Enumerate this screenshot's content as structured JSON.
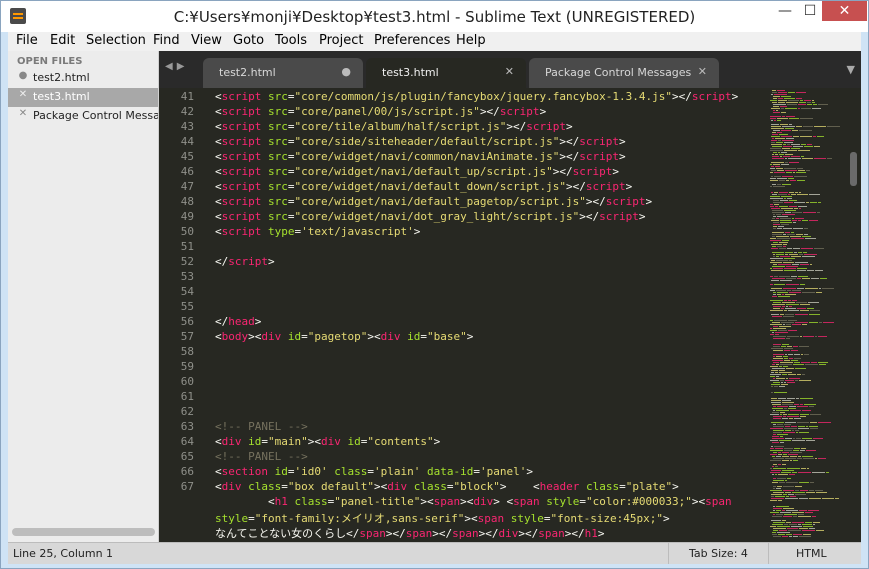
{
  "window": {
    "title": "C:¥Users¥monji¥Desktop¥test3.html - Sublime Text (UNREGISTERED)",
    "min_glyph": "—",
    "max_glyph": "☐",
    "close_glyph": "✕"
  },
  "menu": [
    "File",
    "Edit",
    "Selection",
    "Find",
    "View",
    "Goto",
    "Tools",
    "Project",
    "Preferences",
    "Help"
  ],
  "sidebar": {
    "header": "OPEN FILES",
    "files": [
      {
        "name": "test2.html",
        "mark": "●",
        "active": false
      },
      {
        "name": "test3.html",
        "mark": "✕",
        "active": true
      },
      {
        "name": "Package Control Messages",
        "mark": "✕",
        "active": false
      }
    ]
  },
  "tabs": {
    "nav_left": "◀",
    "nav_right": "▶",
    "dropdown": "▼",
    "items": [
      {
        "label": "test2.html",
        "ctl": "●",
        "active": false
      },
      {
        "label": "test3.html",
        "ctl": "✕",
        "active": true
      },
      {
        "label": "Package Control Messages",
        "ctl": "✕",
        "active": false
      }
    ]
  },
  "editor": {
    "line_numbers": [
      "41",
      "42",
      "43",
      "44",
      "45",
      "46",
      "47",
      "48",
      "49",
      "50",
      "51",
      "52",
      "53",
      "54",
      "55",
      "56",
      "57",
      "58",
      "59",
      "60",
      "61",
      "62",
      "63",
      "64",
      "65",
      "66",
      "67",
      "",
      "",
      ""
    ],
    "lines": [
      [
        [
          "p",
          "<"
        ],
        [
          "t",
          "script"
        ],
        [
          "p",
          " "
        ],
        [
          "a",
          "src"
        ],
        [
          "p",
          "="
        ],
        [
          "s",
          "\"core/common/js/plugin/fancybox/jquery.fancybox-1.3.4.js\""
        ],
        [
          "p",
          "></"
        ],
        [
          "t",
          "script"
        ],
        [
          "p",
          ">"
        ]
      ],
      [
        [
          "p",
          "<"
        ],
        [
          "t",
          "script"
        ],
        [
          "p",
          " "
        ],
        [
          "a",
          "src"
        ],
        [
          "p",
          "="
        ],
        [
          "s",
          "\"core/panel/00/js/script.js\""
        ],
        [
          "p",
          "></"
        ],
        [
          "t",
          "script"
        ],
        [
          "p",
          ">"
        ]
      ],
      [
        [
          "p",
          "<"
        ],
        [
          "t",
          "script"
        ],
        [
          "p",
          " "
        ],
        [
          "a",
          "src"
        ],
        [
          "p",
          "="
        ],
        [
          "s",
          "\"core/tile/album/half/script.js\""
        ],
        [
          "p",
          "></"
        ],
        [
          "t",
          "script"
        ],
        [
          "p",
          ">"
        ]
      ],
      [
        [
          "p",
          "<"
        ],
        [
          "t",
          "script"
        ],
        [
          "p",
          " "
        ],
        [
          "a",
          "src"
        ],
        [
          "p",
          "="
        ],
        [
          "s",
          "\"core/side/siteheader/default/script.js\""
        ],
        [
          "p",
          "></"
        ],
        [
          "t",
          "script"
        ],
        [
          "p",
          ">"
        ]
      ],
      [
        [
          "p",
          "<"
        ],
        [
          "t",
          "script"
        ],
        [
          "p",
          " "
        ],
        [
          "a",
          "src"
        ],
        [
          "p",
          "="
        ],
        [
          "s",
          "\"core/widget/navi/common/naviAnimate.js\""
        ],
        [
          "p",
          "></"
        ],
        [
          "t",
          "script"
        ],
        [
          "p",
          ">"
        ]
      ],
      [
        [
          "p",
          "<"
        ],
        [
          "t",
          "script"
        ],
        [
          "p",
          " "
        ],
        [
          "a",
          "src"
        ],
        [
          "p",
          "="
        ],
        [
          "s",
          "\"core/widget/navi/default_up/script.js\""
        ],
        [
          "p",
          "></"
        ],
        [
          "t",
          "script"
        ],
        [
          "p",
          ">"
        ]
      ],
      [
        [
          "p",
          "<"
        ],
        [
          "t",
          "script"
        ],
        [
          "p",
          " "
        ],
        [
          "a",
          "src"
        ],
        [
          "p",
          "="
        ],
        [
          "s",
          "\"core/widget/navi/default_down/script.js\""
        ],
        [
          "p",
          "></"
        ],
        [
          "t",
          "script"
        ],
        [
          "p",
          ">"
        ]
      ],
      [
        [
          "p",
          "<"
        ],
        [
          "t",
          "script"
        ],
        [
          "p",
          " "
        ],
        [
          "a",
          "src"
        ],
        [
          "p",
          "="
        ],
        [
          "s",
          "\"core/widget/navi/default_pagetop/script.js\""
        ],
        [
          "p",
          "></"
        ],
        [
          "t",
          "script"
        ],
        [
          "p",
          ">"
        ]
      ],
      [
        [
          "p",
          "<"
        ],
        [
          "t",
          "script"
        ],
        [
          "p",
          " "
        ],
        [
          "a",
          "src"
        ],
        [
          "p",
          "="
        ],
        [
          "s",
          "\"core/widget/navi/dot_gray_light/script.js\""
        ],
        [
          "p",
          "></"
        ],
        [
          "t",
          "script"
        ],
        [
          "p",
          ">"
        ]
      ],
      [
        [
          "p",
          "<"
        ],
        [
          "t",
          "script"
        ],
        [
          "p",
          " "
        ],
        [
          "a",
          "type"
        ],
        [
          "p",
          "="
        ],
        [
          "s",
          "'text/javascript'"
        ],
        [
          "p",
          ">"
        ]
      ],
      [],
      [
        [
          "p",
          "</"
        ],
        [
          "t",
          "script"
        ],
        [
          "p",
          ">"
        ]
      ],
      [],
      [],
      [],
      [
        [
          "p",
          "</"
        ],
        [
          "t",
          "head"
        ],
        [
          "p",
          ">"
        ]
      ],
      [
        [
          "p",
          "<"
        ],
        [
          "t",
          "body"
        ],
        [
          "p",
          "><"
        ],
        [
          "t",
          "div"
        ],
        [
          "p",
          " "
        ],
        [
          "a",
          "id"
        ],
        [
          "p",
          "="
        ],
        [
          "s",
          "\"pagetop\""
        ],
        [
          "p",
          "><"
        ],
        [
          "t",
          "div"
        ],
        [
          "p",
          " "
        ],
        [
          "a",
          "id"
        ],
        [
          "p",
          "="
        ],
        [
          "s",
          "\"base\""
        ],
        [
          "p",
          ">"
        ]
      ],
      [],
      [],
      [],
      [],
      [],
      [
        [
          "c",
          "<!-- PANEL -->"
        ]
      ],
      [
        [
          "p",
          "<"
        ],
        [
          "t",
          "div"
        ],
        [
          "p",
          " "
        ],
        [
          "a",
          "id"
        ],
        [
          "p",
          "="
        ],
        [
          "s",
          "\"main\""
        ],
        [
          "p",
          "><"
        ],
        [
          "t",
          "div"
        ],
        [
          "p",
          " "
        ],
        [
          "a",
          "id"
        ],
        [
          "p",
          "="
        ],
        [
          "s",
          "\"contents\""
        ],
        [
          "p",
          ">"
        ]
      ],
      [
        [
          "c",
          "<!-- PANEL -->"
        ]
      ],
      [
        [
          "p",
          "<"
        ],
        [
          "t",
          "section"
        ],
        [
          "p",
          " "
        ],
        [
          "a",
          "id"
        ],
        [
          "p",
          "="
        ],
        [
          "s",
          "'id0'"
        ],
        [
          "p",
          " "
        ],
        [
          "a",
          "class"
        ],
        [
          "p",
          "="
        ],
        [
          "s",
          "'plain'"
        ],
        [
          "p",
          " "
        ],
        [
          "a",
          "data-id"
        ],
        [
          "p",
          "="
        ],
        [
          "s",
          "'panel'"
        ],
        [
          "p",
          ">"
        ]
      ],
      [
        [
          "p",
          "<"
        ],
        [
          "t",
          "div"
        ],
        [
          "p",
          " "
        ],
        [
          "a",
          "class"
        ],
        [
          "p",
          "="
        ],
        [
          "s",
          "\"box default\""
        ],
        [
          "p",
          "><"
        ],
        [
          "t",
          "div"
        ],
        [
          "p",
          " "
        ],
        [
          "a",
          "class"
        ],
        [
          "p",
          "="
        ],
        [
          "s",
          "\"block\""
        ],
        [
          "p",
          ">    <"
        ],
        [
          "t",
          "header"
        ],
        [
          "p",
          " "
        ],
        [
          "a",
          "class"
        ],
        [
          "p",
          "="
        ],
        [
          "s",
          "\"plate\""
        ],
        [
          "p",
          ">"
        ]
      ],
      [
        [
          "p",
          "        <"
        ],
        [
          "t",
          "h1"
        ],
        [
          "p",
          " "
        ],
        [
          "a",
          "class"
        ],
        [
          "p",
          "="
        ],
        [
          "s",
          "\"panel-title\""
        ],
        [
          "p",
          "><"
        ],
        [
          "t",
          "span"
        ],
        [
          "p",
          "><"
        ],
        [
          "t",
          "div"
        ],
        [
          "p",
          "> <"
        ],
        [
          "t",
          "span"
        ],
        [
          "p",
          " "
        ],
        [
          "a",
          "style"
        ],
        [
          "p",
          "="
        ],
        [
          "s",
          "\"color:#000033;\""
        ],
        [
          "p",
          "><"
        ],
        [
          "t",
          "span"
        ]
      ],
      [
        [
          "a",
          "style"
        ],
        [
          "p",
          "="
        ],
        [
          "s",
          "\"font-family:メイリオ,sans-serif\""
        ],
        [
          "p",
          "><"
        ],
        [
          "t",
          "span"
        ],
        [
          "p",
          " "
        ],
        [
          "a",
          "style"
        ],
        [
          "p",
          "="
        ],
        [
          "s",
          "\"font-size:45px;\""
        ],
        [
          "p",
          ">"
        ]
      ],
      [
        [
          "p",
          "なんてことない女のくらし</"
        ],
        [
          "t",
          "span"
        ],
        [
          "p",
          "></"
        ],
        [
          "t",
          "span"
        ],
        [
          "p",
          "></"
        ],
        [
          "t",
          "span"
        ],
        [
          "p",
          "></"
        ],
        [
          "t",
          "div"
        ],
        [
          "p",
          "></"
        ],
        [
          "t",
          "span"
        ],
        [
          "p",
          "></"
        ],
        [
          "t",
          "h1"
        ],
        [
          "p",
          ">"
        ]
      ]
    ]
  },
  "status": {
    "position": "Line 25, Column 1",
    "tab_size": "Tab Size: 4",
    "syntax": "HTML"
  }
}
